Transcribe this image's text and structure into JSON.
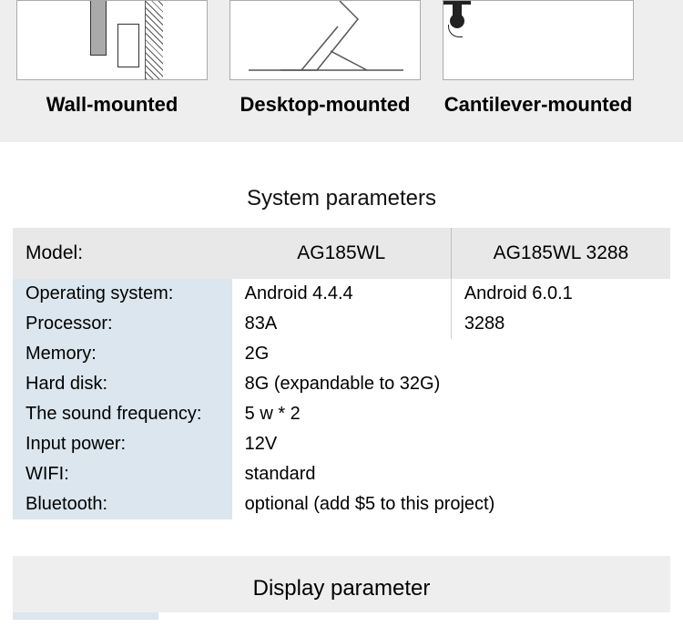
{
  "mounts": {
    "wall": "Wall-mounted",
    "desktop": "Desktop-mounted",
    "cantilever": "Cantilever-mounted"
  },
  "section1_title": "System parameters",
  "header": {
    "model_label": "Model:",
    "col1": "AG185WL",
    "col2": "AG185WL 3288"
  },
  "rows": {
    "os_label": "Operating system:",
    "os_v1": "Android 4.4.4",
    "os_v2": "Android 6.0.1",
    "proc_label": "Processor:",
    "proc_v1": "83A",
    "proc_v2": "3288",
    "mem_label": "Memory:",
    "mem_v": "2G",
    "hdd_label": "Hard disk:",
    "hdd_v": "8G (expandable to 32G)",
    "snd_label": "The sound frequency:",
    "snd_v": "5 w * 2",
    "pwr_label": "Input power:",
    "pwr_v": "12V",
    "wifi_label": "WIFI:",
    "wifi_v": "standard",
    "bt_label": "Bluetooth:",
    "bt_v": "optional (add $5 to this project)"
  },
  "section2_title": "Display parameter"
}
